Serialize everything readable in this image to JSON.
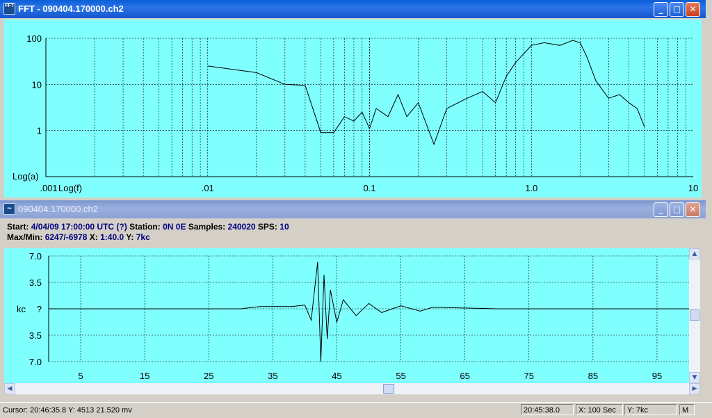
{
  "fft_window": {
    "icon_text": "FFT",
    "title": "FFT - 090404.170000.ch2",
    "buttons": {
      "minimize": "_",
      "maximize": "□",
      "close": "✕"
    },
    "plot": {
      "y_ticks": [
        "100",
        "10",
        "1"
      ],
      "y_label": "Log(a)",
      "x_ticks": [
        ".001",
        ".01",
        "0.1",
        "1.0",
        "10"
      ],
      "x_label": "Log(f)"
    }
  },
  "seis_window": {
    "icon_text": "~",
    "title": "090404.170000.ch2",
    "buttons": {
      "minimize": "_",
      "maximize": "□",
      "close": "✕"
    },
    "info": {
      "start_label": "Start:",
      "start_value": "4/04/09 17:00:00 UTC (?)",
      "station_label": "Station:",
      "station_value": "0N 0E",
      "samples_label": "Samples:",
      "samples_value": "240020",
      "sps_label": "SPS:",
      "sps_value": "10",
      "maxmin_label": "Max/Min:",
      "maxmin_value": "6247/-6978",
      "x_label": "X:",
      "x_value": "1:40.0",
      "y_label": "Y:",
      "y_value": "7kc"
    },
    "plot": {
      "y_ticks": [
        "7.0",
        "3.5",
        "?",
        "3.5",
        "7.0"
      ],
      "unit": "kc",
      "x_ticks": [
        "5",
        "15",
        "25",
        "35",
        "45",
        "55",
        "65",
        "75",
        "85",
        "95"
      ]
    },
    "scroll": {
      "up": "▲",
      "down": "▼",
      "left": "◀",
      "right": "▶"
    }
  },
  "status_bar": {
    "cursor": "Cursor: 20:46:35.8  Y: 4513   21.520 mv",
    "time": "20:45:38.0",
    "x": "X: 100 Sec",
    "y": "Y: 7kc",
    "mode": "M"
  },
  "chart_data": [
    {
      "type": "line",
      "x_scale": "log",
      "y_scale": "log",
      "xlabel": "Log(f)",
      "ylabel": "Log(a)",
      "xlim": [
        0.001,
        10
      ],
      "ylim": [
        0.1,
        100
      ],
      "grid": true,
      "series": [
        {
          "x": [
            0.01,
            0.02,
            0.03,
            0.04,
            0.05,
            0.06,
            0.07,
            0.08,
            0.09,
            0.1,
            0.11,
            0.13,
            0.15,
            0.17,
            0.2,
            0.25,
            0.3,
            0.4,
            0.5,
            0.6,
            0.7,
            0.8,
            1.0,
            1.2,
            1.5,
            1.8,
            2.0,
            2.2,
            2.5,
            3.0,
            3.5,
            4.0,
            4.5,
            5.0
          ],
          "y": [
            25,
            18,
            10,
            9.5,
            0.9,
            0.9,
            2,
            1.6,
            2.5,
            1.1,
            3,
            2,
            6,
            2,
            4,
            0.5,
            3,
            5,
            7,
            4,
            15,
            30,
            70,
            80,
            70,
            90,
            80,
            40,
            12,
            5,
            6,
            4,
            3,
            1.2
          ]
        }
      ]
    },
    {
      "type": "line",
      "xlabel": "",
      "ylabel": "kc",
      "xlim": [
        0,
        100
      ],
      "ylim": [
        -7.0,
        7.0
      ],
      "grid": true,
      "series": [
        {
          "x": [
            0,
            10,
            20,
            30,
            33,
            38,
            40,
            41,
            42,
            42.5,
            43,
            43.5,
            44,
            45,
            46,
            48,
            50,
            52,
            55,
            58,
            60,
            65,
            70,
            80,
            90,
            100
          ],
          "y": [
            0,
            0,
            0,
            0,
            0.3,
            0.3,
            0.5,
            -1.5,
            6.2,
            -7.0,
            4.5,
            -4.0,
            2.5,
            -1.8,
            1.2,
            -0.9,
            0.7,
            -0.5,
            0.4,
            -0.3,
            0.2,
            0.1,
            0,
            0,
            0,
            0
          ]
        }
      ]
    }
  ]
}
